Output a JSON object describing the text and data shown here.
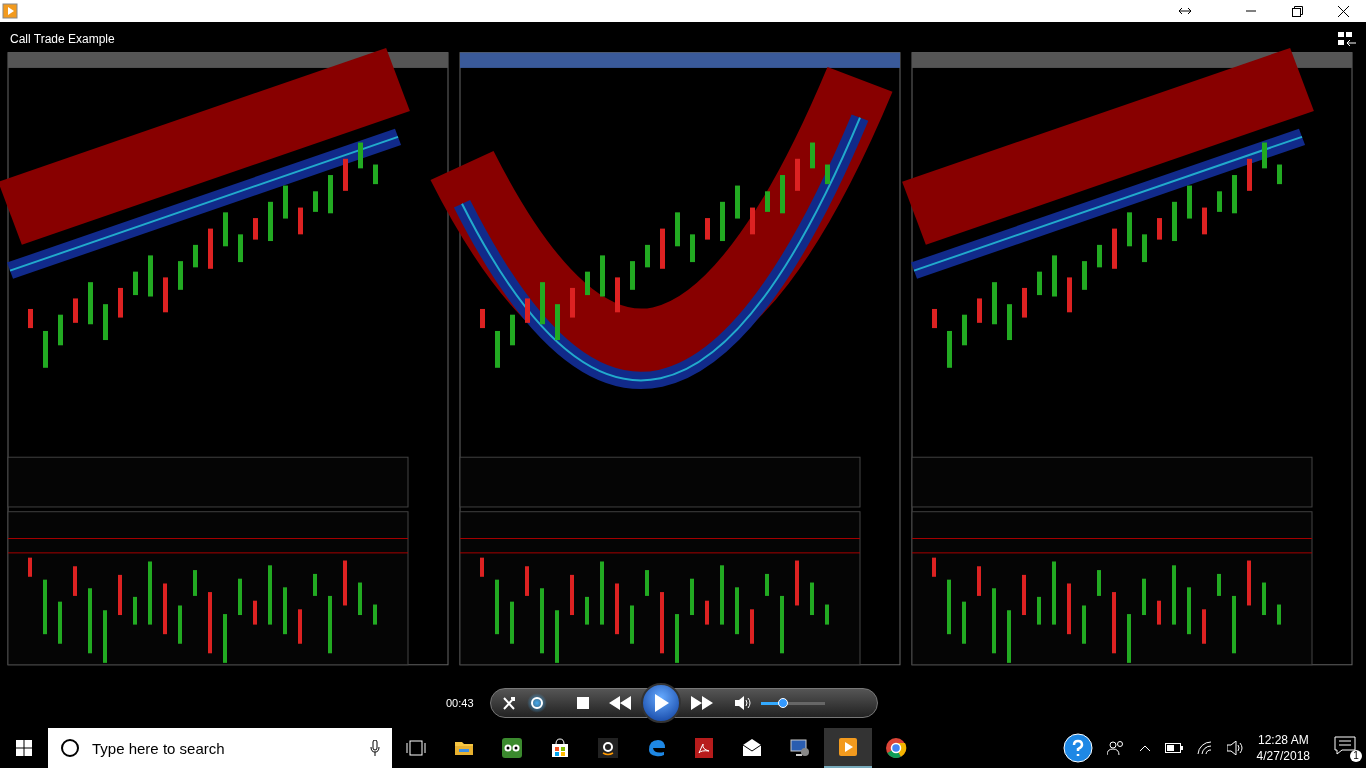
{
  "window": {
    "title": "Call Trade Example"
  },
  "player": {
    "time": "00:43",
    "repeat_on": true,
    "volume": {
      "level": 0.35
    }
  },
  "taskbar": {
    "search": {
      "placeholder": "Type here to search"
    },
    "apps": [
      {
        "kind": "taskview",
        "active": false
      },
      {
        "kind": "folder",
        "active": false
      },
      {
        "kind": "owl",
        "active": false
      },
      {
        "kind": "store",
        "active": false
      },
      {
        "kind": "amazon",
        "active": false
      },
      {
        "kind": "edge",
        "active": false
      },
      {
        "kind": "pdf",
        "active": false
      },
      {
        "kind": "mail",
        "active": false
      },
      {
        "kind": "remote",
        "active": false
      },
      {
        "kind": "player",
        "active": true
      },
      {
        "kind": "chrome",
        "active": false
      }
    ],
    "time": "12:28 AM",
    "date": "4/27/2018",
    "notifications": "1"
  }
}
